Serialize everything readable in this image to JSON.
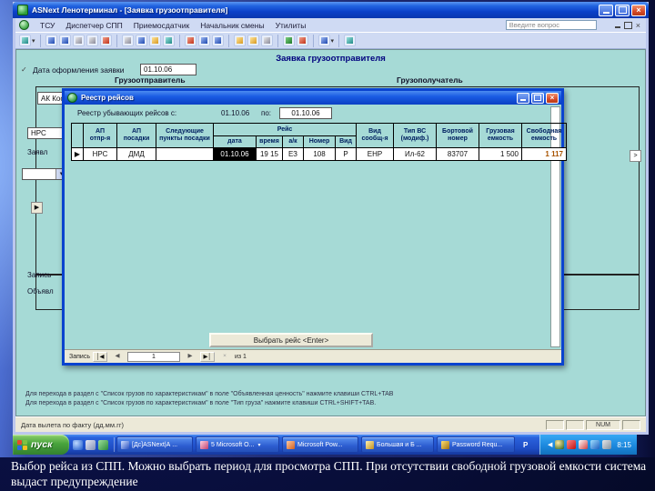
{
  "colors": {
    "form_background": "#a6dad6",
    "selected_cell_bg": "#000000",
    "free_capacity_text": "#a85400",
    "titlebar_blue": "#0b41c9",
    "taskbar_blue": "#2a62dc",
    "start_green": "#48a43c"
  },
  "window": {
    "title": "ASNext Ленотерминал - [Заявка грузоотправителя]",
    "menu": [
      "ТСУ",
      "Диспетчер СПП",
      "Приемосдатчик",
      "Начальник смены",
      "Утилиты"
    ],
    "help_box": "Введите вопрос",
    "close_glyph": "×"
  },
  "toolbar": {
    "icons": [
      "edit-mode",
      "save",
      "save-all",
      "print",
      "print-preview",
      "spelling",
      "cut",
      "copy",
      "paste",
      "undo",
      "add-user",
      "sort-asc",
      "sort-desc",
      "filter-by-selection",
      "filter",
      "find",
      "new-record",
      "delete-record",
      "copy-record",
      "help"
    ]
  },
  "form": {
    "title": "Заявка грузоотправителя",
    "date_label": "Дата оформления заявки",
    "date_value": "01.10.06",
    "shipper_header": "Грузоотправитель",
    "consignee_header": "Грузополучатель",
    "shipper_value": "АК Кос",
    "fragment_nrs": "НРС",
    "fragment_zayavl": "Заявл",
    "fragment_zapis": "Запись",
    "fragment_obyavl": "Объявл",
    "row_arrow": "▶",
    "lookup_arrow": ">",
    "hint1": "Для перехода в раздел с \"Список грузов по характеристикам\" в поле \"Объявленная ценность\" нажмите клавиши CTRL+TAB",
    "hint2": "Для перехода в раздел с \"Список грузов по характеристикам\" в поле \"Тип груза\" нажмите клавиши CTRL+SHIFT+TAB.",
    "status_left": "Дата вылета по факту (дд.мм.гг)",
    "status_num": "NUM",
    "edit_glyph": "✓"
  },
  "dialog": {
    "title": "Реестр рейсов",
    "period_label": "Реестр убывающих рейсов с:",
    "period_from": "01.10.06",
    "to_label": "по:",
    "period_to": "01.10.06",
    "select_button": "Выбрать рейс <Enter>",
    "close_glyph": "×",
    "table": {
      "headers": [
        [
          "АП",
          "отпр-я"
        ],
        [
          "АП",
          "посадки"
        ],
        [
          "Следующие",
          "пункты посадки"
        ],
        [
          "Вид",
          "сообщ-я"
        ],
        [
          "Тип ВС",
          "(модиф.)"
        ],
        [
          "Бортовой",
          "номер"
        ],
        [
          "Грузовая",
          "емкость"
        ],
        [
          "Свободная",
          "емкость"
        ]
      ],
      "reis": {
        "label": "Рейс",
        "subs": [
          "дата",
          "время",
          "а/к",
          "Номер",
          "Вид"
        ]
      },
      "row": {
        "selector": "▶",
        "ap_dep": "НРС",
        "ap_pos": "ДМД",
        "next_points": "",
        "date": "01.10.06",
        "time": "19 15",
        "airline": "ЕЗ",
        "number": "108",
        "vid": "Р",
        "vid_soob": "ЕНР",
        "tip_vs": "Ил-62",
        "bort": "83707",
        "gruz": "1 500",
        "svob": "1 117"
      }
    },
    "navigator": {
      "label": "Запись",
      "first": "│◀",
      "prev": "◀",
      "value": "1",
      "next": "▶",
      "last": "▶│",
      "extra": "×",
      "of": "из 1"
    }
  },
  "taskbar": {
    "start": "пуск",
    "tasks": [
      {
        "label": "[Дс]ASNext|А ..."
      },
      {
        "label": "5 Microsoft O..."
      },
      {
        "label": "Microsoft Pow..."
      },
      {
        "label": "Большая и Б ..."
      },
      {
        "label": "Password Requ..."
      }
    ],
    "lang": "Р",
    "time": "8:15"
  },
  "caption": {
    "text": "Выбор рейса из СПП. Можно выбрать период для просмотра СПП. При отсутствии свободной грузовой емкости система выдаст предупреждение"
  }
}
